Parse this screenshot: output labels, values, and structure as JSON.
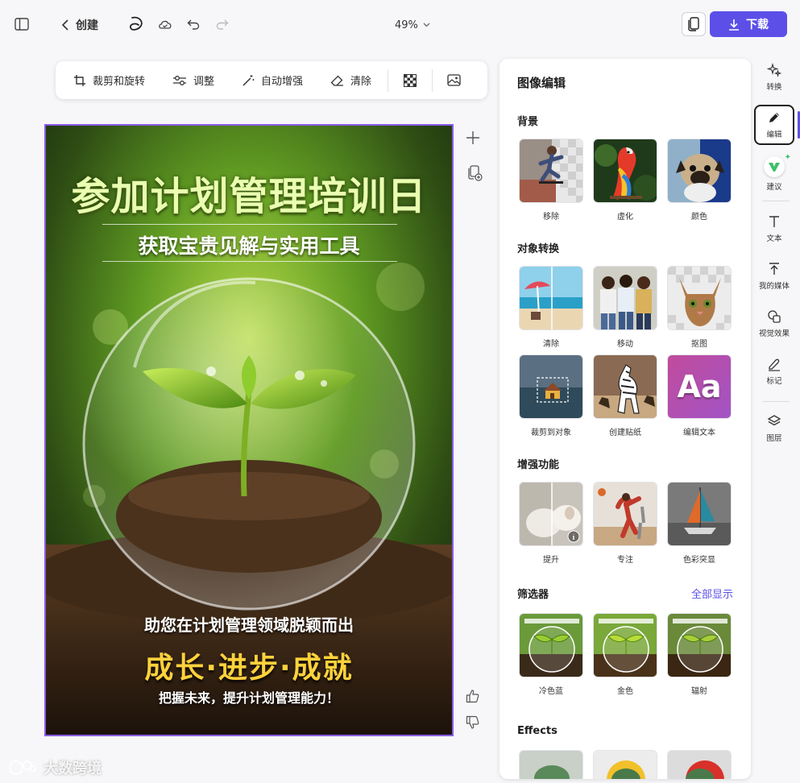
{
  "topbar": {
    "create_label": "创建",
    "zoom_label": "49%",
    "download_label": "下载"
  },
  "edit_toolbar": {
    "crop_rotate": "裁剪和旋转",
    "adjust": "调整",
    "auto_enhance": "自动增强",
    "erase": "清除"
  },
  "poster": {
    "title": "参加计划管理培训日",
    "subtitle": "获取宝贵见解与实用工具",
    "tagline": "助您在计划管理领域脱颖而出",
    "slogan": "成长·进步·成就",
    "footer": "把握未来，提升计划管理能力！"
  },
  "panel": {
    "title": "图像编辑",
    "background": {
      "title": "背景",
      "items": [
        {
          "label": "移除",
          "icon": "skateboarder-thumb"
        },
        {
          "label": "虚化",
          "icon": "parrot-thumb"
        },
        {
          "label": "颜色",
          "icon": "pug-thumb"
        }
      ]
    },
    "object_transform": {
      "title": "对象转换",
      "items": [
        {
          "label": "清除",
          "icon": "beach-thumb"
        },
        {
          "label": "移动",
          "icon": "friends-thumb"
        },
        {
          "label": "抠图",
          "icon": "cat-thumb"
        },
        {
          "label": "裁剪到对象",
          "icon": "house-thumb"
        },
        {
          "label": "创建贴纸",
          "icon": "zebra-thumb"
        },
        {
          "label": "编辑文本",
          "icon": "text-thumb",
          "text": "Aa"
        }
      ]
    },
    "enhance": {
      "title": "增强功能",
      "items": [
        {
          "label": "提升",
          "icon": "sheep-thumb"
        },
        {
          "label": "专注",
          "icon": "basketball-thumb"
        },
        {
          "label": "色彩突显",
          "icon": "sailboat-thumb"
        }
      ]
    },
    "filters": {
      "title": "筛选器",
      "show_all": "全部显示",
      "items": [
        {
          "label": "冷色蓝"
        },
        {
          "label": "金色"
        },
        {
          "label": "辐射"
        }
      ]
    },
    "effects": {
      "title": "Effects"
    }
  },
  "rail": {
    "items": [
      {
        "label": "转换"
      },
      {
        "label": "编辑"
      },
      {
        "label": "建议"
      },
      {
        "label": "文本"
      },
      {
        "label": "我的媒体"
      },
      {
        "label": "视觉效果"
      },
      {
        "label": "标记"
      },
      {
        "label": "图层"
      }
    ]
  },
  "watermark": "大数跨境",
  "colors": {
    "accent": "#5b4fe8",
    "selection": "#8a5ce6",
    "link": "#5b4fe8"
  }
}
